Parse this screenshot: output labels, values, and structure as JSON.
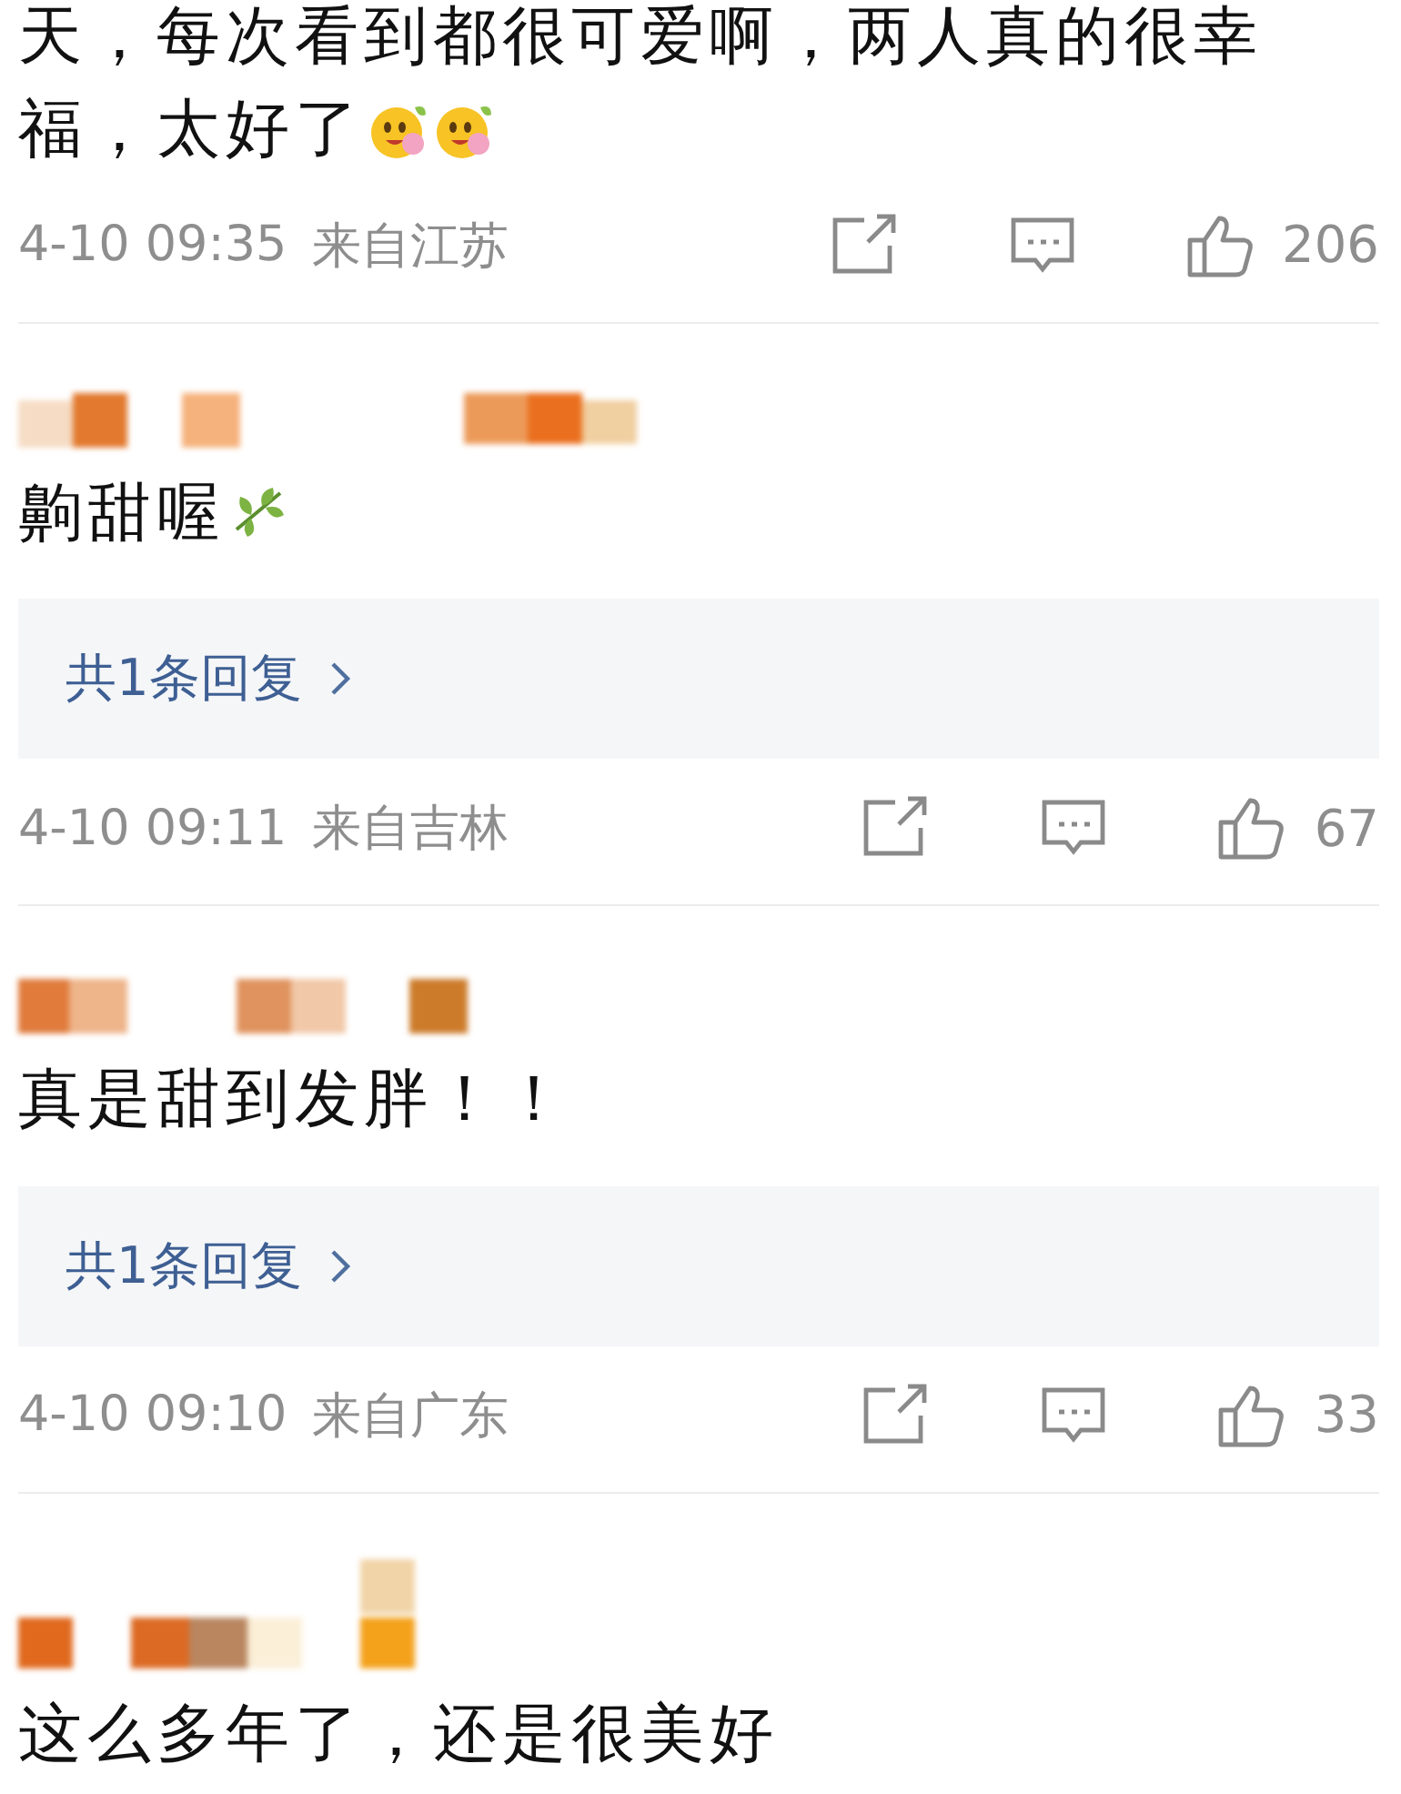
{
  "comments": [
    {
      "name_hidden": false,
      "text": "天，每次看到都很可爱啊，两人真的很幸福，太好了",
      "emoji": [
        {
          "kind": "smiley"
        },
        {
          "kind": "smiley"
        }
      ],
      "time": "4-10 09:35",
      "location": "来自江苏",
      "likes": "206"
    },
    {
      "name_hidden": true,
      "text": "齁甜喔",
      "emoji": [
        {
          "kind": "leaf"
        }
      ],
      "replies": "共1条回复",
      "time": "4-10 09:11",
      "location": "来自吉林",
      "likes": "67"
    },
    {
      "name_hidden": true,
      "text": "真是甜到发胖！！",
      "replies": "共1条回复",
      "time": "4-10 09:10",
      "location": "来自广东",
      "likes": "33"
    },
    {
      "name_hidden": true,
      "text": "这么多年了，还是很美好"
    }
  ]
}
